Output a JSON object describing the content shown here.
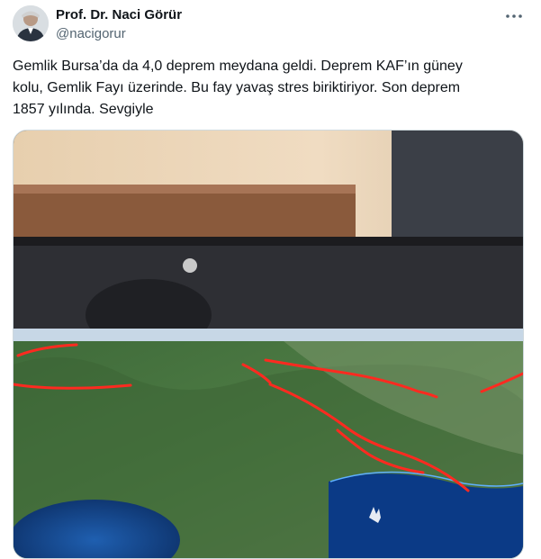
{
  "tweet": {
    "author_name": "Prof. Dr. Naci Görür",
    "author_handle": "@nacigorur",
    "text": "Gemlik Bursa’da da 4,0 deprem meydana geldi. Deprem KAF’ın güney\nkolu, Gemlik Fayı üzerinde. Bu fay yavaş stres biriktiriyor. Son deprem\n1857 yılında. Sevgiyle",
    "more_icon": "ellipsis-icon",
    "media_description": "photo of a monitor showing a satellite map with red fault lines"
  }
}
